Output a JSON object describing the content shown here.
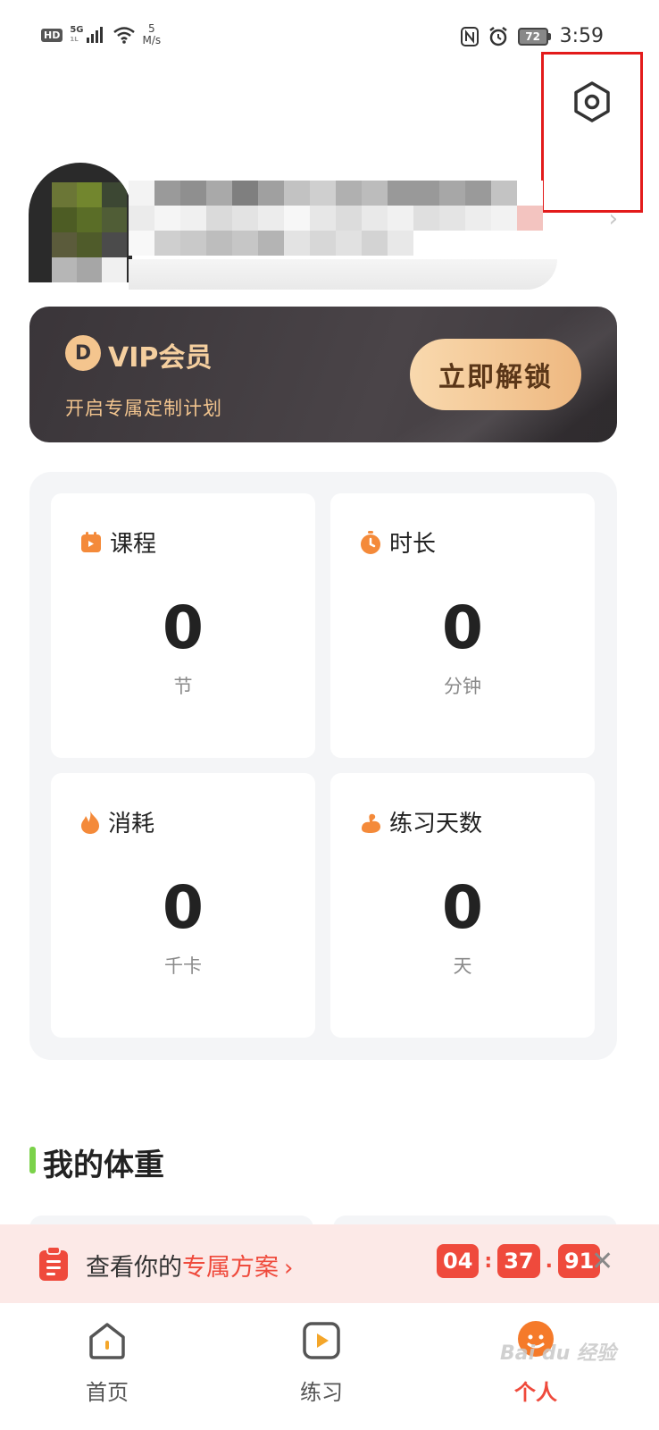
{
  "status_bar": {
    "hd": "HD",
    "network": "5G",
    "network_sub": "1L",
    "speed_value": "5",
    "speed_unit": "M/s",
    "battery": "72",
    "time": "3:59"
  },
  "vip": {
    "logo_letter": "D",
    "title": "VIP会员",
    "subtitle": "开启专属定制计划",
    "button": "立即解锁"
  },
  "stats": [
    {
      "label": "课程",
      "value": "0",
      "unit": "节",
      "icon": "calendar-icon"
    },
    {
      "label": "时长",
      "value": "0",
      "unit": "分钟",
      "icon": "stopwatch-icon"
    },
    {
      "label": "消耗",
      "value": "0",
      "unit": "千卡",
      "icon": "flame-icon"
    },
    {
      "label": "练习天数",
      "value": "0",
      "unit": "天",
      "icon": "muscle-icon"
    }
  ],
  "weight": {
    "title": "我的体重"
  },
  "promo": {
    "text_prefix": "查看你的",
    "text_highlight": "专属方案",
    "arrow": "›",
    "timer": [
      "04",
      "37",
      "91"
    ],
    "sep1": ":",
    "sep2": ".",
    "close": "✕"
  },
  "nav": [
    {
      "label": "首页",
      "icon": "home-icon"
    },
    {
      "label": "练习",
      "icon": "play-icon"
    },
    {
      "label": "个人",
      "icon": "profile-icon",
      "active": true
    }
  ],
  "watermark": "Bai du 经验",
  "colors": {
    "accent": "#ef4a3c",
    "vip_gold": "#f5cf9f",
    "vip_bg": "#3a3539",
    "weight_bar": "#7bd24a",
    "highlight_box": "#e31b1b"
  }
}
